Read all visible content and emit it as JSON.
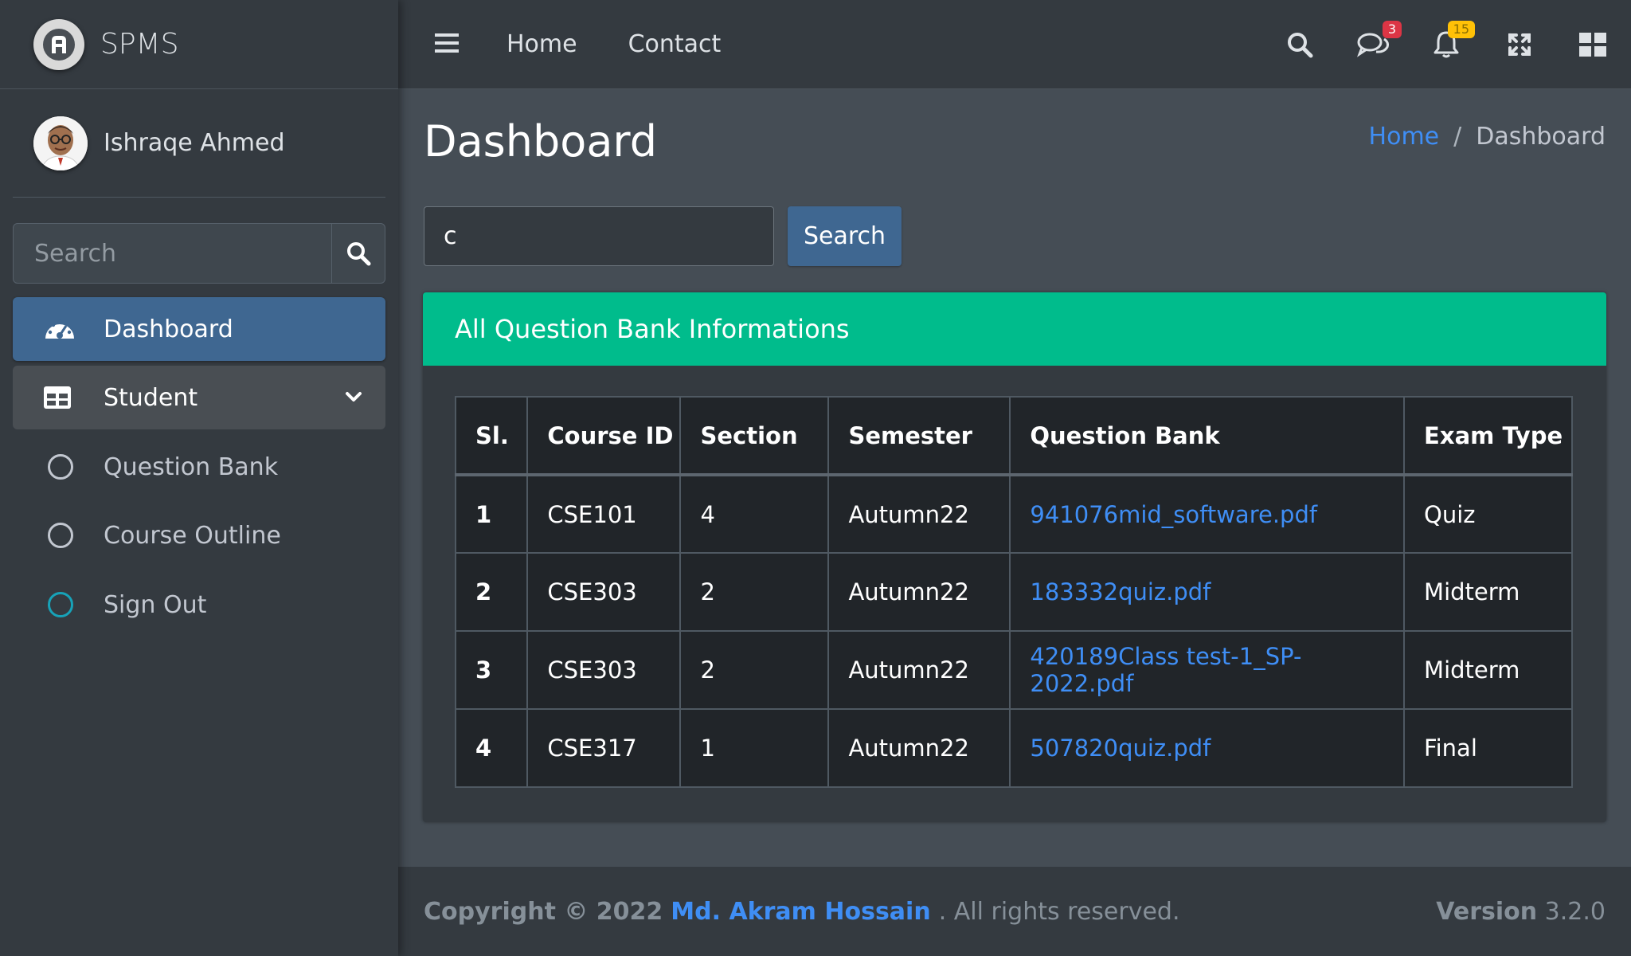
{
  "brand": {
    "name": "SPMS"
  },
  "user": {
    "name": "Ishraqe Ahmed"
  },
  "sidebar": {
    "search_placeholder": "Search",
    "items": [
      {
        "label": "Dashboard",
        "icon": "tachometer-icon",
        "active": true
      },
      {
        "label": "Student",
        "icon": "table-icon",
        "expanded": true
      },
      {
        "label": "Question Bank",
        "icon": "circle-icon"
      },
      {
        "label": "Course Outline",
        "icon": "circle-icon"
      },
      {
        "label": "Sign Out",
        "icon": "circle-icon"
      }
    ]
  },
  "topbar": {
    "links": [
      "Home",
      "Contact"
    ],
    "messages_badge": "3",
    "notifications_badge": "15"
  },
  "page": {
    "title": "Dashboard",
    "breadcrumb": {
      "home": "Home",
      "separator": "/",
      "current": "Dashboard"
    }
  },
  "search": {
    "value": "c",
    "button_label": "Search"
  },
  "card": {
    "title": "All Question Bank Informations"
  },
  "table": {
    "headers": [
      "Sl.",
      "Course ID",
      "Section",
      "Semester",
      "Question Bank",
      "Exam Type"
    ],
    "rows": [
      {
        "sl": "1",
        "course_id": "CSE101",
        "section": "4",
        "semester": "Autumn22",
        "file": "941076mid_software.pdf",
        "exam_type": "Quiz"
      },
      {
        "sl": "2",
        "course_id": "CSE303",
        "section": "2",
        "semester": "Autumn22",
        "file": "183332quiz.pdf",
        "exam_type": "Midterm"
      },
      {
        "sl": "3",
        "course_id": "CSE303",
        "section": "2",
        "semester": "Autumn22",
        "file": "420189Class test-1_SP-2022.pdf",
        "exam_type": "Midterm"
      },
      {
        "sl": "4",
        "course_id": "CSE317",
        "section": "1",
        "semester": "Autumn22",
        "file": "507820quiz.pdf",
        "exam_type": "Final"
      }
    ]
  },
  "footer": {
    "copyright": "Copyright © 2022",
    "author": "Md. Akram Hossain",
    "rights": ". All rights reserved.",
    "version_label": "Version",
    "version": "3.2.0"
  },
  "colors": {
    "sidebar_bg": "#343a40",
    "content_bg": "#454d55",
    "primary": "#3f6791",
    "success": "#00bc8c",
    "link": "#3f8ef5",
    "danger": "#dc3545",
    "warning": "#ffc107"
  }
}
